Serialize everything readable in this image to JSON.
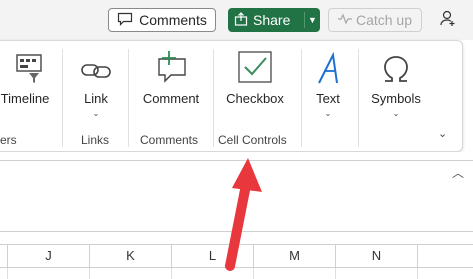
{
  "toolbar": {
    "comments_label": "Comments",
    "share_label": "Share",
    "catchup_label": "Catch up"
  },
  "ribbon": {
    "tools": [
      {
        "label": "Timeline",
        "icon": "timeline-icon"
      },
      {
        "label": "Link",
        "icon": "link-icon"
      },
      {
        "label": "Comment",
        "icon": "comment-icon"
      },
      {
        "label": "Checkbox",
        "icon": "checkbox-icon"
      },
      {
        "label": "Text",
        "icon": "text-icon"
      },
      {
        "label": "Symbols",
        "icon": "omega-icon"
      }
    ],
    "groups": [
      {
        "label": "ers"
      },
      {
        "label": "Links"
      },
      {
        "label": "Comments"
      },
      {
        "label": "Cell Controls"
      }
    ]
  },
  "sheet": {
    "columns": [
      "J",
      "K",
      "L",
      "M",
      "N"
    ]
  },
  "colors": {
    "share_green": "#217346",
    "arrow_red": "#e8383d",
    "checkbox_green": "#3a8c5c",
    "text_blue": "#1f6fd1"
  }
}
